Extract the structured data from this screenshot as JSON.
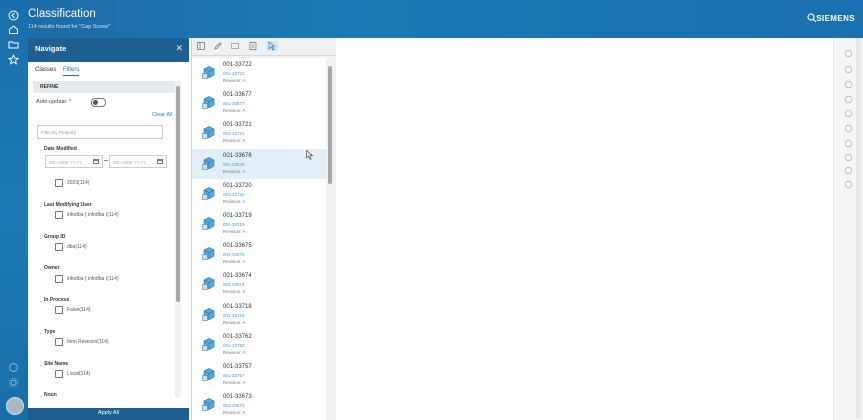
{
  "header": {
    "title": "Classification",
    "subtitle": "114 results found for \"Cap Screw\"",
    "brand": "SIEMENS",
    "search_icon": "search-icon"
  },
  "rail": {
    "icons": [
      "back-arrow-icon",
      "home-icon",
      "folder-icon",
      "star-icon",
      "help-icon",
      "settings-icon"
    ]
  },
  "navigate": {
    "title": "Navigate",
    "close_icon": "close-icon",
    "tabs": [
      {
        "label": "Classes"
      },
      {
        "label": "Filters"
      }
    ],
    "refine_label": "REFINE",
    "auto_update_label": "Auto-update: *",
    "clear_all": "Clear All",
    "filter_placeholder": "Filter By Property",
    "date_modified": {
      "title": "Date Modified",
      "from_placeholder": "DD-MMM-YYYY",
      "to_placeholder": "DD-MMM-YYYY",
      "option": "2023(114)"
    },
    "sections": [
      {
        "title": "Last Modifying User",
        "option": "infodba ( infodba )(114)"
      },
      {
        "title": "Group ID",
        "option": "dba(114)"
      },
      {
        "title": "Owner",
        "option": "infodba ( infodba )(114)"
      },
      {
        "title": "In Process",
        "option": "False(114)"
      },
      {
        "title": "Type",
        "option": "Item Revision(114)"
      },
      {
        "title": "Site Name",
        "option": "Local(114)"
      },
      {
        "title": "Noun",
        "option": ""
      }
    ],
    "apply_label": "Apply All"
  },
  "results": {
    "toolbar_icons": [
      "layout-icon",
      "edit-icon",
      "list-icon",
      "table-icon",
      "select-icon"
    ],
    "items": [
      {
        "id": "001-33722",
        "sub": "001-33722",
        "rev": "Revision:  A"
      },
      {
        "id": "001-33677",
        "sub": "001-33677",
        "rev": "Revision:  A"
      },
      {
        "id": "001-33721",
        "sub": "001-33721",
        "rev": "Revision:  A"
      },
      {
        "id": "001-33676",
        "sub": "001-33676",
        "rev": "Revision:  A"
      },
      {
        "id": "001-33720",
        "sub": "001-33720",
        "rev": "Revision:  A"
      },
      {
        "id": "001-33719",
        "sub": "001-33719",
        "rev": "Revision:  A"
      },
      {
        "id": "001-33675",
        "sub": "001-33675",
        "rev": "Revision:  A"
      },
      {
        "id": "001-33674",
        "sub": "001-33674",
        "rev": "Revision:  A"
      },
      {
        "id": "001-33718",
        "sub": "001-33718",
        "rev": "Revision:  A"
      },
      {
        "id": "001-33762",
        "sub": "001-33762",
        "rev": "Revision:  A"
      },
      {
        "id": "001-33757",
        "sub": "001-33757",
        "rev": "Revision:  A"
      },
      {
        "id": "001-33673",
        "sub": "001-33673",
        "rev": "Revision:  A"
      }
    ],
    "highlighted_index": 3
  },
  "right_rail": {
    "icons": [
      "info-icon",
      "expand-icon",
      "pin-icon",
      "copy-icon",
      "folder-icon",
      "add-icon",
      "edit-icon",
      "tools-icon",
      "share-icon",
      "view-icon"
    ]
  },
  "colors": {
    "header": "#1b7ab7",
    "panel_header": "#1c5f90",
    "link": "#2b86c6"
  }
}
